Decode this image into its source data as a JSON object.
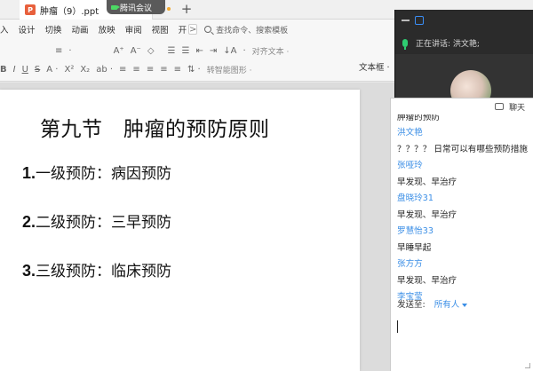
{
  "tabbar": {
    "doc_icon": "ppt-file-icon",
    "doc_icon_glyph": "P",
    "doc_title": "肿瘤（9）.ppt",
    "meeting_label": "腾讯会议",
    "add_tab_symbol": "+"
  },
  "menubar": {
    "items": [
      "入",
      "设计",
      "切换",
      "动画",
      "放映",
      "审阅",
      "视图",
      "开"
    ],
    "more_symbol": ">",
    "search_placeholder": "查找命令、搜索模板"
  },
  "toolbar": {
    "row1": [
      "≡",
      "·",
      "A⁺",
      "A⁻",
      "◇",
      "☰",
      "☰",
      "⇤",
      "⇥",
      "↓A",
      "·"
    ],
    "row1_align_text": "对齐文本 ·",
    "row2": [
      "B",
      "I",
      "U",
      "S",
      "A ·",
      "X²",
      "X₂",
      "ab ·",
      "≡",
      "≡",
      "≡",
      "≡",
      "≡",
      "⇅ ·"
    ],
    "row2_smartart": "转智能图形 ·",
    "textbox_label": "文本框 ·"
  },
  "slide": {
    "title": "第九节　肿瘤的预防原则",
    "items": [
      {
        "num": "1.",
        "text": "一级预防：病因预防"
      },
      {
        "num": "2.",
        "text": "二级预防：三早预防"
      },
      {
        "num": "3.",
        "text": "三级预防：临床预防"
      }
    ]
  },
  "meeting": {
    "speaking_label": "正在讲话: 洪文艳;"
  },
  "chat": {
    "header_label": "聊天",
    "messages": [
      {
        "type": "msg",
        "text": "肿瘤的预防"
      },
      {
        "type": "name",
        "text": "洪文艳"
      },
      {
        "type": "msg",
        "text": "？？？？ 日常可以有哪些预防措施"
      },
      {
        "type": "name",
        "text": "张哑玲"
      },
      {
        "type": "msg",
        "text": "早发现、早治疗"
      },
      {
        "type": "name",
        "text": "盘晓玲31"
      },
      {
        "type": "msg",
        "text": "早发现、早治疗"
      },
      {
        "type": "name",
        "text": "罗慧怡33"
      },
      {
        "type": "msg",
        "text": "早睡早起"
      },
      {
        "type": "name",
        "text": "张方方"
      },
      {
        "type": "msg",
        "text": "早发现、早治疗"
      },
      {
        "type": "name",
        "text": "李宝莹"
      }
    ],
    "send_to_label": "发送至:",
    "send_to_value": "所有人"
  }
}
